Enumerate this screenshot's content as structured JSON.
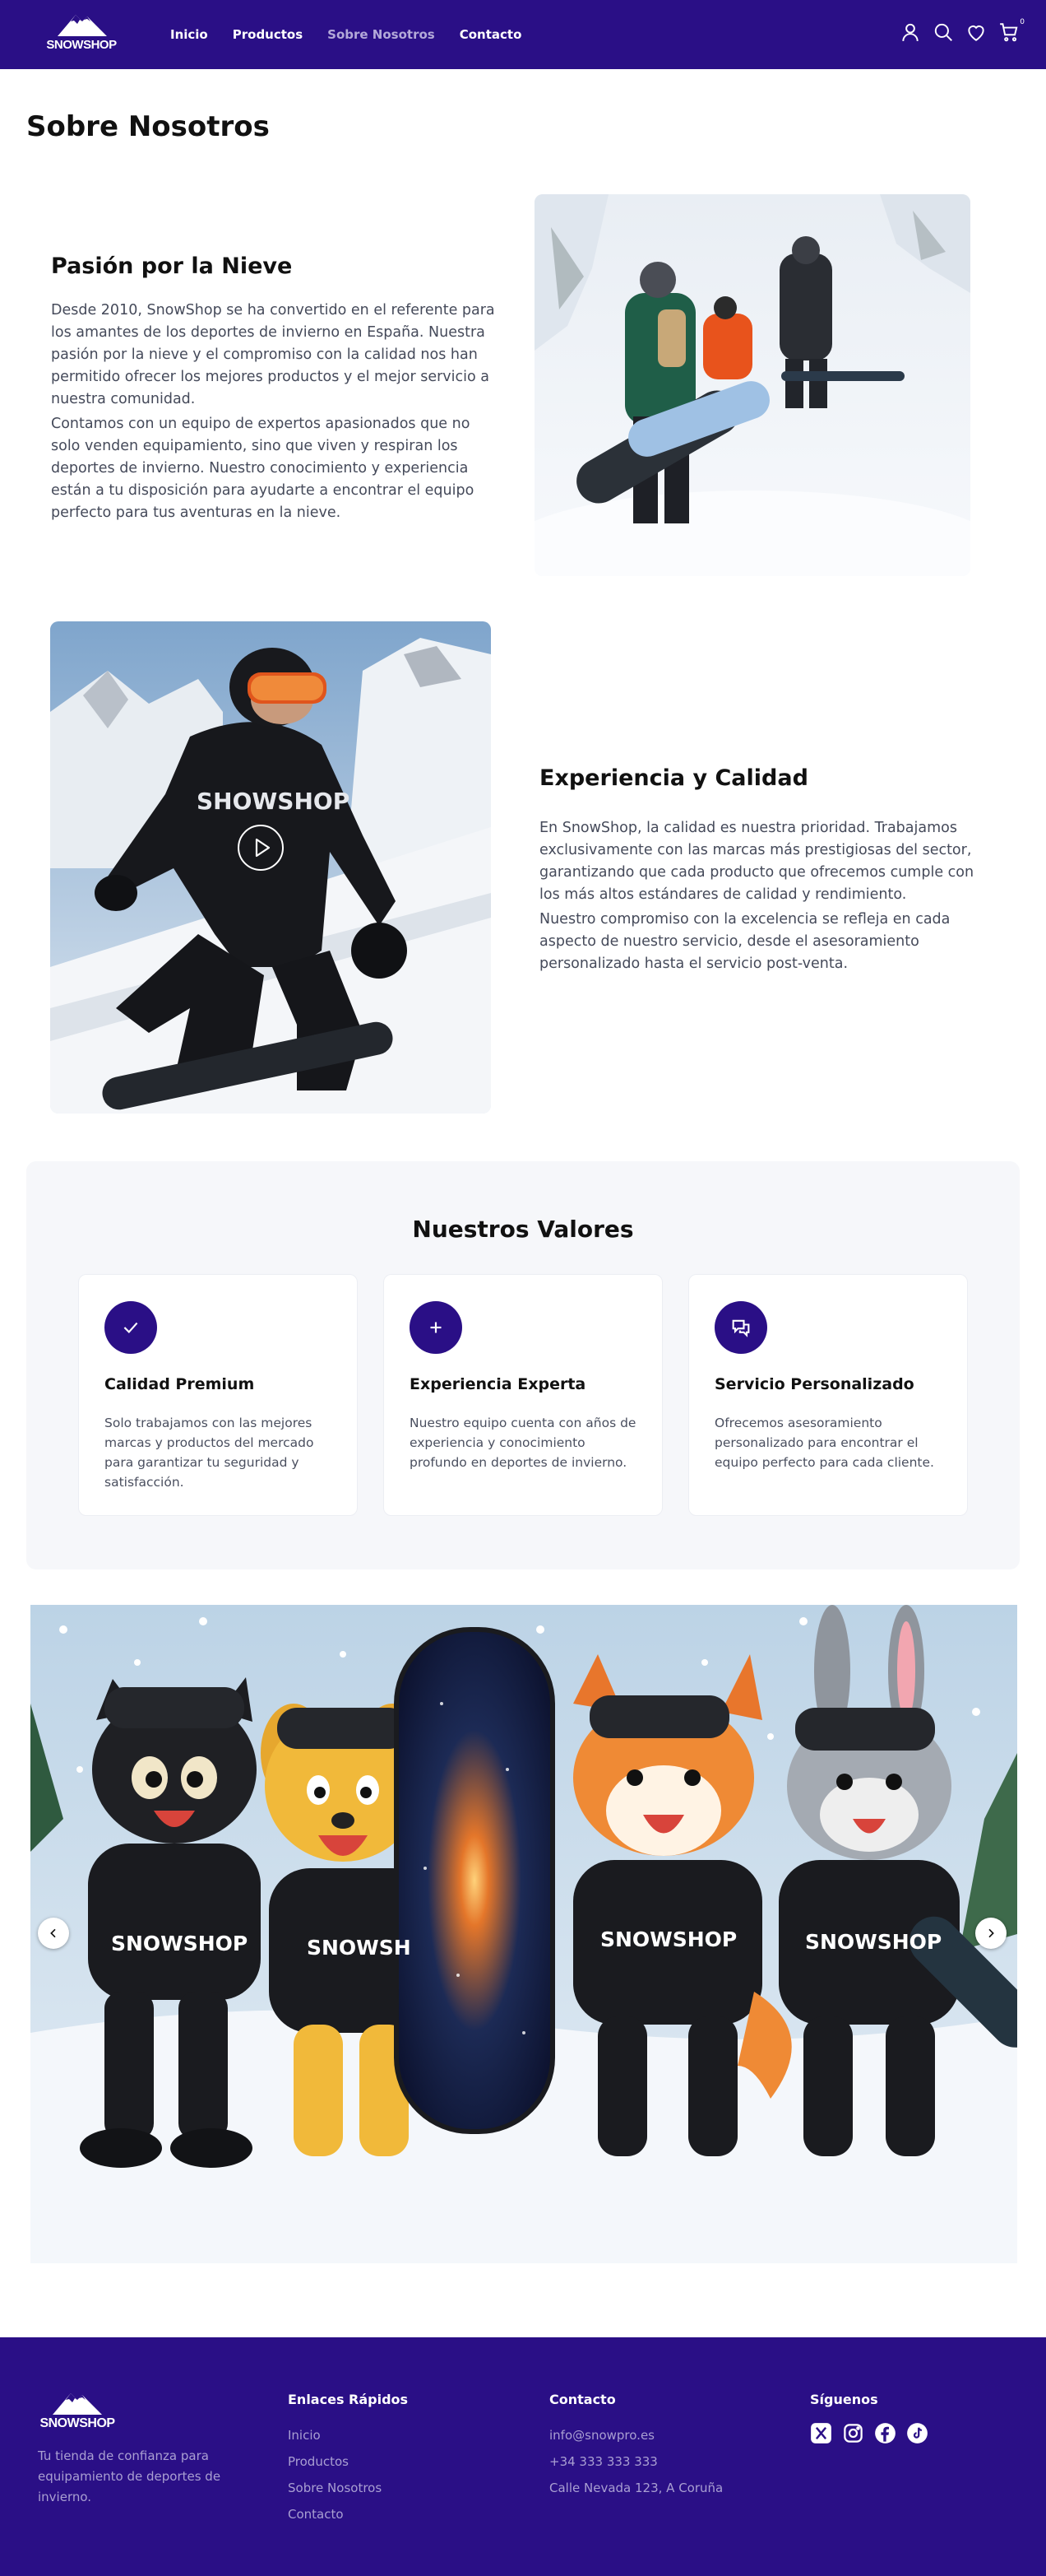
{
  "brand": {
    "name": "SNOWSHOP"
  },
  "nav": {
    "links": [
      {
        "label": "Inicio",
        "active": false
      },
      {
        "label": "Productos",
        "active": false
      },
      {
        "label": "Sobre Nosotros",
        "active": true
      },
      {
        "label": "Contacto",
        "active": false
      }
    ],
    "icons": [
      "user-icon",
      "search-icon",
      "heart-icon",
      "cart-icon"
    ],
    "cart_count": "0"
  },
  "page": {
    "title": "Sobre Nosotros"
  },
  "section_passion": {
    "heading": "Pasión por la Nieve",
    "paragraphs": [
      "Desde 2010, SnowShop se ha convertido en el referente para los amantes de los deportes de invierno en España. Nuestra pasión por la nieve y el compromiso con la calidad nos han permitido ofrecer los mejores productos y el mejor servicio a nuestra comunidad.",
      "Contamos con un equipo de expertos apasionados que no solo venden equipamiento, sino que viven y respiran los deportes de invierno. Nuestro conocimiento y experiencia están a tu disposición para ayudarte a encontrar el equipo perfecto para tus aventuras en la nieve."
    ]
  },
  "section_quality": {
    "heading": "Experiencia y Calidad",
    "video_brand": "SHOWSHOP",
    "paragraphs": [
      "En SnowShop, la calidad es nuestra prioridad. Trabajamos exclusivamente con las marcas más prestigiosas del sector, garantizando que cada producto que ofrecemos cumple con los más altos estándares de calidad y rendimiento.",
      "Nuestro compromiso con la excelencia se refleja en cada aspecto de nuestro servicio, desde el asesoramiento personalizado hasta el servicio post-venta."
    ]
  },
  "values": {
    "title": "Nuestros Valores",
    "cards": [
      {
        "icon": "check-icon",
        "title": "Calidad Premium",
        "body": "Solo trabajamos con las mejores marcas y productos del mercado para garantizar tu seguridad y satisfacción."
      },
      {
        "icon": "plus-icon",
        "title": "Experiencia Experta",
        "body": "Nuestro equipo cuenta con años de experiencia y conocimiento profundo en deportes de invierno."
      },
      {
        "icon": "chat-icon",
        "title": "Servicio Personalizado",
        "body": "Ofrecemos asesoramiento personalizado para encontrar el equipo perfecto para cada cliente."
      }
    ]
  },
  "carousel": {
    "hoodie_texts": [
      "SNOWSHOP",
      "SNOWSH",
      "SNOWSHOP",
      "SNOWSHOP"
    ]
  },
  "footer": {
    "tagline": "Tu tienda de confianza para equipamiento de deportes de invierno.",
    "links_title": "Enlaces Rápidos",
    "links": [
      "Inicio",
      "Productos",
      "Sobre Nosotros",
      "Contacto"
    ],
    "contact_title": "Contacto",
    "contact": [
      "info@snowpro.es",
      "+34 333 333 333",
      "Calle Nevada 123, A Coruña"
    ],
    "social_title": "Síguenos",
    "social": [
      "x-icon",
      "instagram-icon",
      "facebook-icon",
      "tiktok-icon"
    ]
  },
  "colors": {
    "brand": "#2a0f86",
    "muted_text": "#454a5a",
    "footer_link": "#a99fd2"
  }
}
